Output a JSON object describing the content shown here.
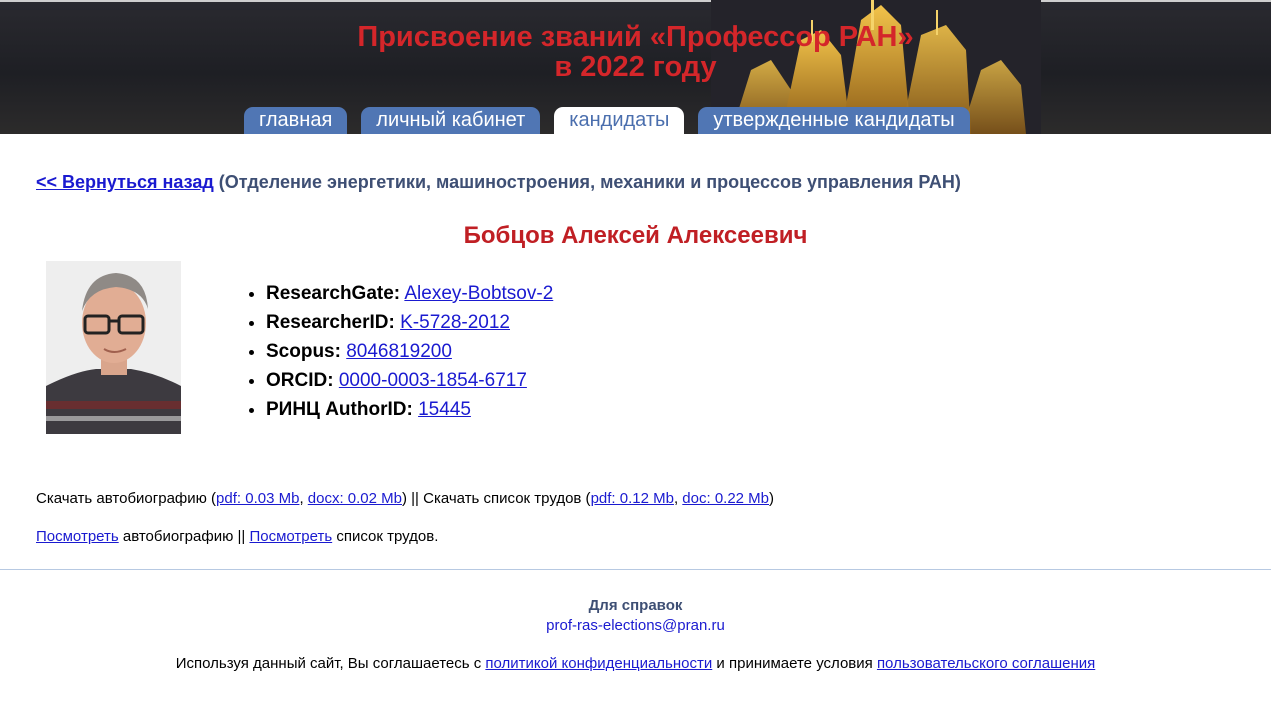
{
  "header": {
    "title_line1": "Присвоение званий «Профессор РАН»",
    "title_line2": "в 2022 году",
    "tabs": [
      {
        "label": "главная",
        "active": false
      },
      {
        "label": "личный кабинет",
        "active": false
      },
      {
        "label": "кандидаты",
        "active": true
      },
      {
        "label": "утвержденные кандидаты",
        "active": false
      }
    ]
  },
  "breadcrumb": {
    "back_link": "<< Вернуться назад",
    "department": "(Отделение энергетики, машиностроения, механики и процессов управления РАН)"
  },
  "person": {
    "name": "Бобцов Алексей Алексеевич",
    "ids": [
      {
        "label": "ResearchGate:",
        "value": "Alexey-Bobtsov-2"
      },
      {
        "label": "ResearcherID:",
        "value": "K-5728-2012"
      },
      {
        "label": "Scopus:",
        "value": "8046819200"
      },
      {
        "label": "ORCID:",
        "value": "0000-0003-1854-6717"
      },
      {
        "label": "РИНЦ AuthorID:",
        "value": "15445"
      }
    ]
  },
  "downloads": {
    "bio_prefix": "Скачать автобиографию (",
    "bio_pdf": "pdf: 0.03 Mb",
    "bio_docx": "docx: 0.02 Mb",
    "separator": ") || Скачать список трудов (",
    "works_pdf": "pdf: 0.12 Mb",
    "works_doc": "doc: 0.22 Mb",
    "suffix": ")"
  },
  "view": {
    "link1": "Посмотреть",
    "text1": " автобиографию || ",
    "link2": "Посмотреть",
    "text2": " список трудов."
  },
  "footer": {
    "title": "Для справок",
    "email": "prof-ras-elections@pran.ru",
    "policy_prefix": "Используя данный сайт, Вы соглашаетесь с ",
    "policy_link": "политикой конфиденциальности",
    "policy_middle": " и принимаете условия ",
    "agreement_link": "пользовательского соглашения"
  },
  "colors": {
    "title_red": "#d4262a",
    "tab_blue": "#5076b4",
    "link_blue": "#1a1ad0",
    "name_red": "#c01f24"
  }
}
